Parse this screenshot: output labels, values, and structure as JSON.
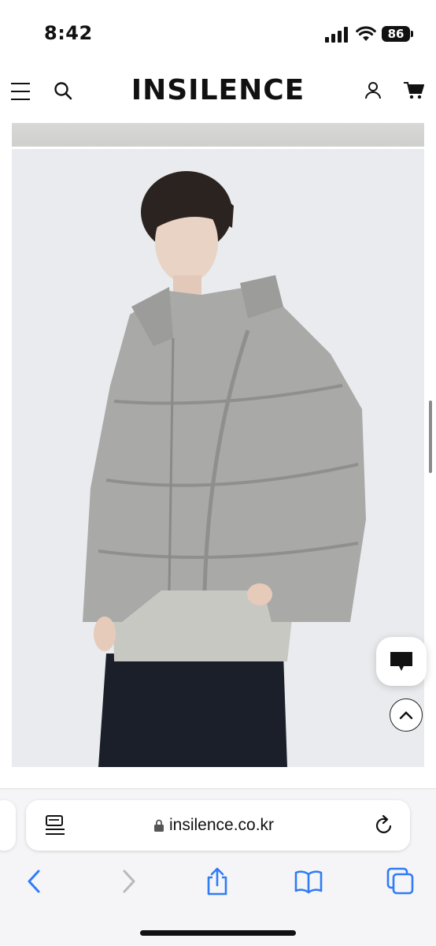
{
  "status_bar": {
    "time": "8:42",
    "battery": "86",
    "icons": [
      "signal-icon",
      "wifi-icon",
      "battery-icon"
    ]
  },
  "header": {
    "brand": "INSILENCE",
    "icons": [
      "menu-icon",
      "search-icon",
      "account-icon",
      "cart-icon"
    ]
  },
  "product": {
    "images": [
      "product-image-strip",
      "product-photo-puffer-jacket"
    ],
    "jacket_color": "#a9a9a7"
  },
  "floating": {
    "icons": [
      "chat-icon",
      "chevron-up-icon"
    ]
  },
  "browser": {
    "url": "insilence.co.kr",
    "icons": [
      "reader-icon",
      "lock-icon",
      "reload-icon"
    ],
    "toolbar": [
      "back-icon",
      "forward-icon",
      "share-icon",
      "bookmarks-icon",
      "tabs-icon"
    ],
    "accent": "#2f7cf6"
  }
}
